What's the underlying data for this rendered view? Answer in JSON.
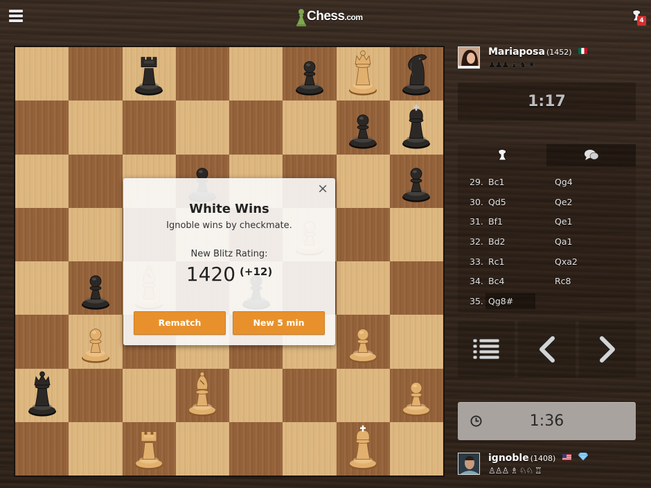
{
  "topbar": {
    "logo_main": "Chess",
    "logo_suffix": ".com",
    "notification_count": "4",
    "icons": {
      "menu": "hamburger-menu-icon",
      "notifications": "pawn-alert-icon"
    }
  },
  "colors": {
    "accent_orange": "#e8912c",
    "light_square": "#deb880",
    "dark_square": "#98653c",
    "badge_red": "#d32f2f",
    "logo_green": "#7fa650"
  },
  "board": {
    "orientation": "white-bottom",
    "pieces": [
      {
        "square": "c8",
        "color": "black",
        "type": "rook"
      },
      {
        "square": "f8",
        "color": "black",
        "type": "pawn"
      },
      {
        "square": "g8",
        "color": "white",
        "type": "queen"
      },
      {
        "square": "h8",
        "color": "black",
        "type": "knight"
      },
      {
        "square": "g7",
        "color": "black",
        "type": "pawn"
      },
      {
        "square": "h7",
        "color": "black",
        "type": "king"
      },
      {
        "square": "d6",
        "color": "black",
        "type": "pawn"
      },
      {
        "square": "h6",
        "color": "black",
        "type": "pawn"
      },
      {
        "square": "f5",
        "color": "white",
        "type": "pawn"
      },
      {
        "square": "b4",
        "color": "black",
        "type": "pawn"
      },
      {
        "square": "c4",
        "color": "white",
        "type": "bishop"
      },
      {
        "square": "e4",
        "color": "black",
        "type": "pawn"
      },
      {
        "square": "b3",
        "color": "white",
        "type": "pawn"
      },
      {
        "square": "g3",
        "color": "white",
        "type": "pawn"
      },
      {
        "square": "a2",
        "color": "black",
        "type": "queen"
      },
      {
        "square": "d2",
        "color": "white",
        "type": "bishop"
      },
      {
        "square": "h2",
        "color": "white",
        "type": "pawn"
      },
      {
        "square": "c1",
        "color": "white",
        "type": "rook"
      },
      {
        "square": "g1",
        "color": "white",
        "type": "king"
      }
    ]
  },
  "modal": {
    "title": "White Wins",
    "subtitle": "Ignoble wins by checkmate.",
    "rating_label": "New Blitz Rating:",
    "rating_value": "1420",
    "rating_delta": "(+12)",
    "close_label": "×",
    "buttons": {
      "rematch": "Rematch",
      "new_game": "New 5 min"
    }
  },
  "opponent": {
    "name": "Mariaposa",
    "rating": "(1452)",
    "flag": "Mexico",
    "captured": "♟♟♟ ♝ ♞ ♜",
    "clock": "1:17"
  },
  "player": {
    "name": "ignoble",
    "rating": "(1408)",
    "flag": "United States",
    "badge": "diamond-membership-icon",
    "captured": "♙♙♙ ♗ ♘♘ ♖",
    "clock": "1:36"
  },
  "moves_panel": {
    "tabs": [
      {
        "name": "moves",
        "icon": "pawn-moves-icon",
        "active": true
      },
      {
        "name": "chat",
        "icon": "chat-bubbles-icon",
        "active": false
      }
    ],
    "moves": [
      {
        "num": "29.",
        "white": "Bc1",
        "black": "Qg4"
      },
      {
        "num": "30.",
        "white": "Qd5",
        "black": "Qe2"
      },
      {
        "num": "31.",
        "white": "Bf1",
        "black": "Qe1"
      },
      {
        "num": "32.",
        "white": "Bd2",
        "black": "Qa1"
      },
      {
        "num": "33.",
        "white": "Rc1",
        "black": "Qxa2"
      },
      {
        "num": "34.",
        "white": "Bc4",
        "black": "Rc8"
      },
      {
        "num": "35.",
        "white": "Qg8#",
        "black": ""
      }
    ],
    "current_move": "35. Qg8#"
  },
  "controls": {
    "list_button": "move-list-icon",
    "prev_button": "chevron-left-icon",
    "next_button": "chevron-right-icon"
  }
}
